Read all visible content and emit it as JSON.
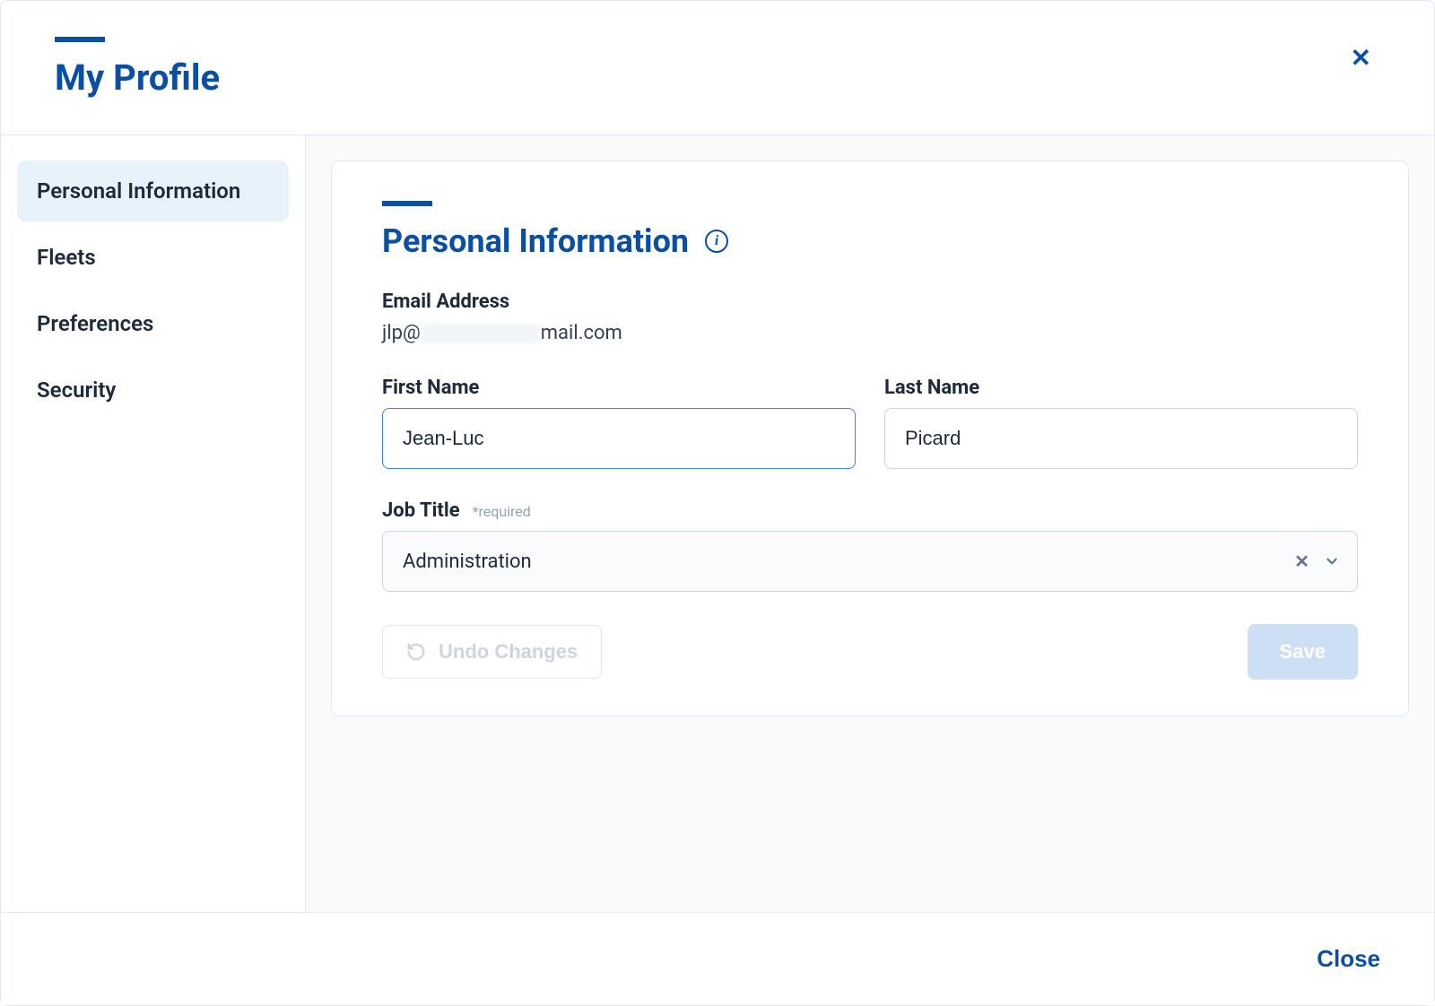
{
  "header": {
    "title": "My Profile",
    "close_icon": "✕"
  },
  "sidebar": {
    "items": [
      {
        "label": "Personal Information",
        "active": true
      },
      {
        "label": "Fleets",
        "active": false
      },
      {
        "label": "Preferences",
        "active": false
      },
      {
        "label": "Security",
        "active": false
      }
    ]
  },
  "section": {
    "title": "Personal Information",
    "info_glyph": "i"
  },
  "fields": {
    "email_label": "Email Address",
    "email_prefix": "jlp@",
    "email_suffix": "mail.com",
    "first_name_label": "First Name",
    "first_name_value": "Jean-Luc",
    "last_name_label": "Last Name",
    "last_name_value": "Picard",
    "job_title_label": "Job Title",
    "job_title_required": "*required",
    "job_title_value": "Administration",
    "clear_glyph": "✕"
  },
  "actions": {
    "undo_label": "Undo Changes",
    "save_label": "Save"
  },
  "footer": {
    "close_label": "Close"
  }
}
